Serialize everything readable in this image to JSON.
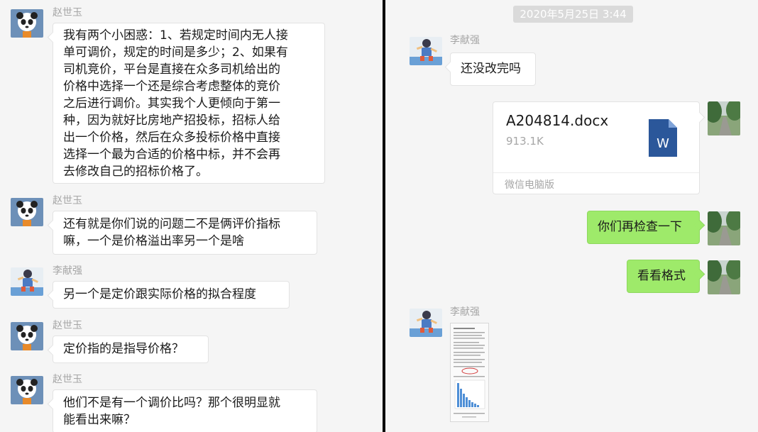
{
  "left_chat": {
    "messages": [
      {
        "sender": "赵世玉",
        "lines": [
          "我有两个小困惑：1、若规定时间内无人接",
          "单可调价，规定的时间是多少；2、如果有",
          "司机竞价，平台是直接在众多司机给出的",
          "价格中选择一个还是综合考虑整体的竞价",
          "之后进行调价。其实我个人更倾向于第一",
          "种，因为就好比房地产招投标，招标人给",
          "出一个价格，然后在众多投标价格中直接",
          "选择一个最为合适的价格中标，并不会再",
          "去修改自己的招标价格了。"
        ]
      },
      {
        "sender": "赵世玉",
        "lines": [
          "还有就是你们说的问题二不是俩评价指标",
          "嘛，一个是价格溢出率另一个是啥"
        ]
      },
      {
        "sender": "李献强",
        "lines": [
          "另一个是定价跟实际价格的拟合程度"
        ]
      },
      {
        "sender": "赵世玉",
        "lines": [
          "定价指的是指导价格？"
        ]
      },
      {
        "sender": "赵世玉",
        "lines": [
          "他们不是有一个调价比吗？那个很明显就",
          "能看出来嘛？"
        ]
      }
    ]
  },
  "right_chat": {
    "timestamp": "2020年5月25日 3:44",
    "msg1": {
      "sender": "李献强",
      "text": "还没改完吗"
    },
    "file": {
      "name": "A204814.docx",
      "size": "913.1K",
      "source": "微信电脑版",
      "icon_letter": "W"
    },
    "msg2": {
      "text": "你们再检查一下"
    },
    "msg3": {
      "text": "看看格式"
    },
    "msg4": {
      "sender": "李献强"
    }
  },
  "icons": {
    "avatar_a": "panda-avatar-icon",
    "avatar_b": "cartoon-runner-avatar-icon",
    "avatar_me": "tree-road-avatar-icon",
    "file": "word-document-icon"
  },
  "colors": {
    "chat_bg": "#f5f5f5",
    "bubble_received": "#ffffff",
    "bubble_sent": "#9eea6a",
    "name_text": "#a6a6a6",
    "word_blue": "#2b579a",
    "divider": "#000000"
  }
}
